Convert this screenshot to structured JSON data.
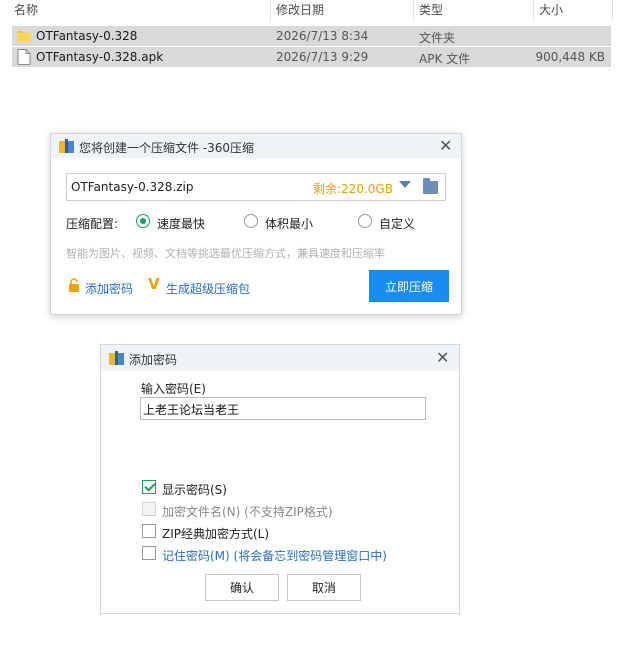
{
  "explorer": {
    "columns": [
      "名称",
      "修改日期",
      "类型",
      "大小"
    ],
    "files": [
      {
        "name": "OTFantasy-0.328",
        "date": "2026/7/13 8:34",
        "type": "文件夹",
        "size": "",
        "icon": "folder-icon"
      },
      {
        "name": "OTFantasy-0.328.apk",
        "date": "2026/7/13 9:29",
        "type": "APK 文件",
        "size": "900,448 KB",
        "icon": "file-icon"
      }
    ]
  },
  "compress_dialog": {
    "title": "您将创建一个压缩文件 -360压缩",
    "filename": "OTFantasy-0.328.zip",
    "remaining": "剩余:220.0GB",
    "config_label": "压缩配置:",
    "options": [
      {
        "label": "速度最快",
        "selected": true
      },
      {
        "label": "体积最小",
        "selected": false
      },
      {
        "label": "自定义",
        "selected": false
      }
    ],
    "hint": "智能为图片、视频、文档等挑选最优压缩方式，兼具速度和压缩率",
    "add_password": "添加密码",
    "super_package": "生成超级压缩包",
    "compress_button": "立即压缩",
    "accent_color": "#1a8cf0"
  },
  "password_dialog": {
    "title": "添加密码",
    "input_label": "输入密码(E)",
    "password_value": "上老王论坛当老王",
    "checkboxes": [
      {
        "label": "显示密码(S)",
        "note": "",
        "checked": true,
        "disabled": false
      },
      {
        "label": "加密文件名(N)",
        "note": "(不支持ZIP格式)",
        "checked": false,
        "disabled": true
      },
      {
        "label": "ZIP经典加密方式(L)",
        "note": "",
        "checked": false,
        "disabled": false
      },
      {
        "label": "记住密码(M)",
        "note": "(将会备忘到密码管理窗口中)",
        "checked": false,
        "disabled": false
      }
    ],
    "ok_label": "确认",
    "cancel_label": "取消"
  }
}
